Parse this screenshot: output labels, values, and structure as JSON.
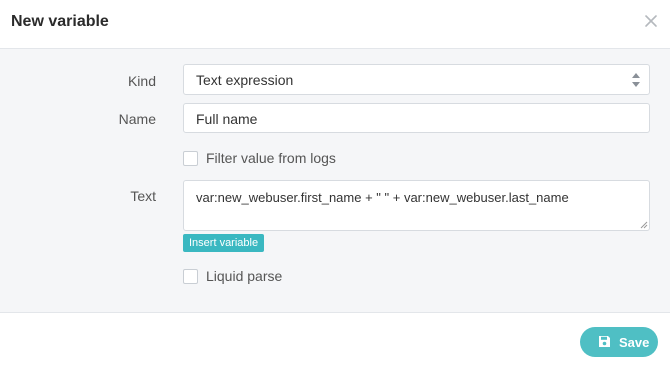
{
  "dialog": {
    "title": "New variable",
    "close_icon": "close-icon"
  },
  "form": {
    "kind": {
      "label": "Kind",
      "value": "Text expression",
      "icon": "select-arrows-icon"
    },
    "name": {
      "label": "Name",
      "value": "Full name"
    },
    "filter_logs": {
      "label": "Filter value from logs",
      "checked": false
    },
    "text": {
      "label": "Text",
      "value": "var:new_webuser.first_name + \" \" + var:new_webuser.last_name"
    },
    "insert_variable_label": "Insert variable",
    "liquid_parse": {
      "label": "Liquid parse",
      "checked": false
    }
  },
  "footer": {
    "save_label": "Save",
    "save_icon": "floppy-disk-icon"
  },
  "colors": {
    "accent": "#3ab8c1",
    "save_button": "#4fbfc4",
    "body_background": "#f5f6f8",
    "border": "#d7dbe0"
  }
}
